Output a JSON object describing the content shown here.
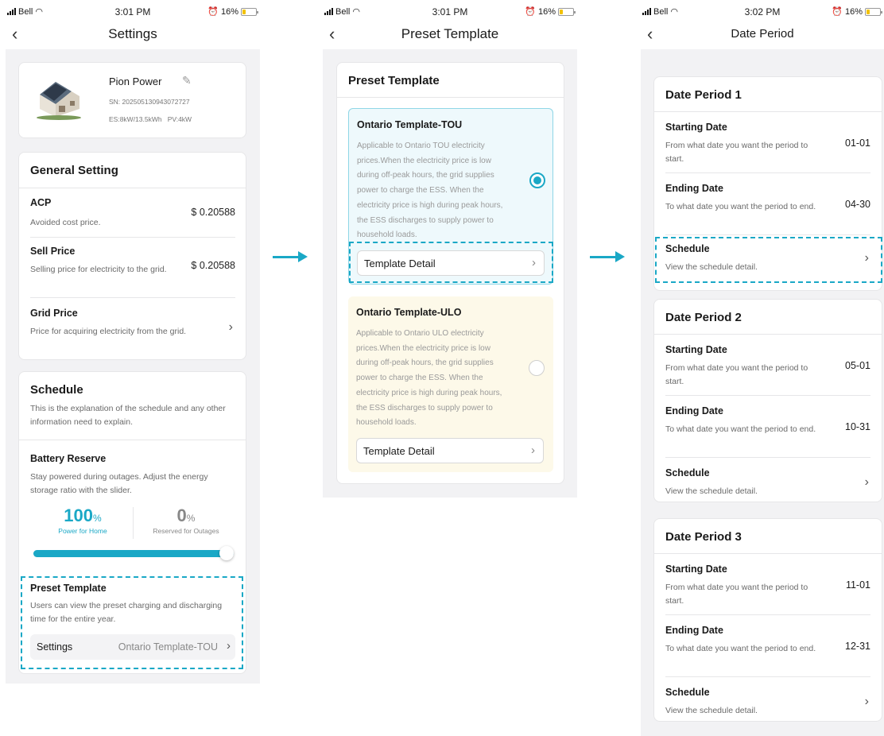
{
  "status_bars": [
    {
      "carrier": "Bell",
      "time": "3:01 PM",
      "battery": "16%"
    },
    {
      "carrier": "Bell",
      "time": "3:01 PM",
      "battery": "16%"
    },
    {
      "carrier": "Bell",
      "time": "3:02 PM",
      "battery": "16%"
    }
  ],
  "settings": {
    "title": "Settings",
    "device": {
      "name": "Pion Power",
      "sn": "SN: 202505130943072727",
      "specs": "ES:8kW/13.5kWh   PV:4kW"
    },
    "general": {
      "header": "General Setting",
      "acp": {
        "label": "ACP",
        "desc": "Avoided cost price.",
        "value": "$ 0.20588"
      },
      "sell": {
        "label": "Sell Price",
        "desc": "Selling price for electricity to the grid.",
        "value": "$ 0.20588"
      },
      "grid": {
        "label": "Grid Price",
        "desc": "Price for acquiring electricity from the grid."
      }
    },
    "schedule": {
      "header": "Schedule",
      "desc": "This is the explanation of the schedule and any other information need to explain.",
      "reserve": {
        "label": "Battery Reserve",
        "desc": "Stay powered during outages. Adjust the energy storage ratio with the slider.",
        "home_value": "100",
        "home_unit": "%",
        "home_label": "Power for Home",
        "outage_value": "0",
        "outage_unit": "%",
        "outage_label": "Reserved for Outages",
        "slider_fraction": 1.0
      },
      "preset": {
        "label": "Preset Template",
        "desc": "Users can view the preset charging and discharging time for the entire year.",
        "row_label": "Settings",
        "row_value": "Ontario Template-TOU"
      }
    }
  },
  "preset_screen": {
    "title": "Preset Template",
    "card_header": "Preset Template",
    "templates": [
      {
        "name": "Ontario Template-TOU",
        "desc": "Applicable to Ontario TOU electricity prices.When the electricity price is low during off-peak hours, the grid supplies power to charge the ESS. When the electricity price is high during peak hours, the ESS discharges to supply power to household loads.",
        "button": "Template Detail",
        "selected": true
      },
      {
        "name": "Ontario Template-ULO",
        "desc": "Applicable to Ontario ULO electricity prices.When the electricity price is low during off-peak hours, the grid supplies power to charge the ESS. When the electricity price is high during peak hours, the ESS discharges to supply power to household loads.",
        "button": "Template Detail",
        "selected": false
      }
    ]
  },
  "date_screen": {
    "title": "Date Period",
    "periods": [
      {
        "header": "Date Period 1",
        "start_label": "Starting Date",
        "start_desc": "From what date you want the period to start.",
        "start": "01-01",
        "end_label": "Ending Date",
        "end_desc": "To what date you want the period to end.",
        "end": "04-30",
        "sched_label": "Schedule",
        "sched_desc": "View the schedule detail."
      },
      {
        "header": "Date Period 2",
        "start_label": "Starting Date",
        "start_desc": "From what date you want the period to start.",
        "start": "05-01",
        "end_label": "Ending Date",
        "end_desc": "To what date you want the period to end.",
        "end": "10-31",
        "sched_label": "Schedule",
        "sched_desc": "View the schedule detail."
      },
      {
        "header": "Date Period 3",
        "start_label": "Starting Date",
        "start_desc": "From what date you want the period to start.",
        "start": "11-01",
        "end_label": "Ending Date",
        "end_desc": "To what date you want the period to end.",
        "end": "12-31",
        "sched_label": "Schedule",
        "sched_desc": "View the schedule detail."
      }
    ]
  },
  "colors": {
    "accent": "#1aa8c6",
    "tou_bg": "#eef9fc",
    "ulo_bg": "#fdf9e9"
  }
}
